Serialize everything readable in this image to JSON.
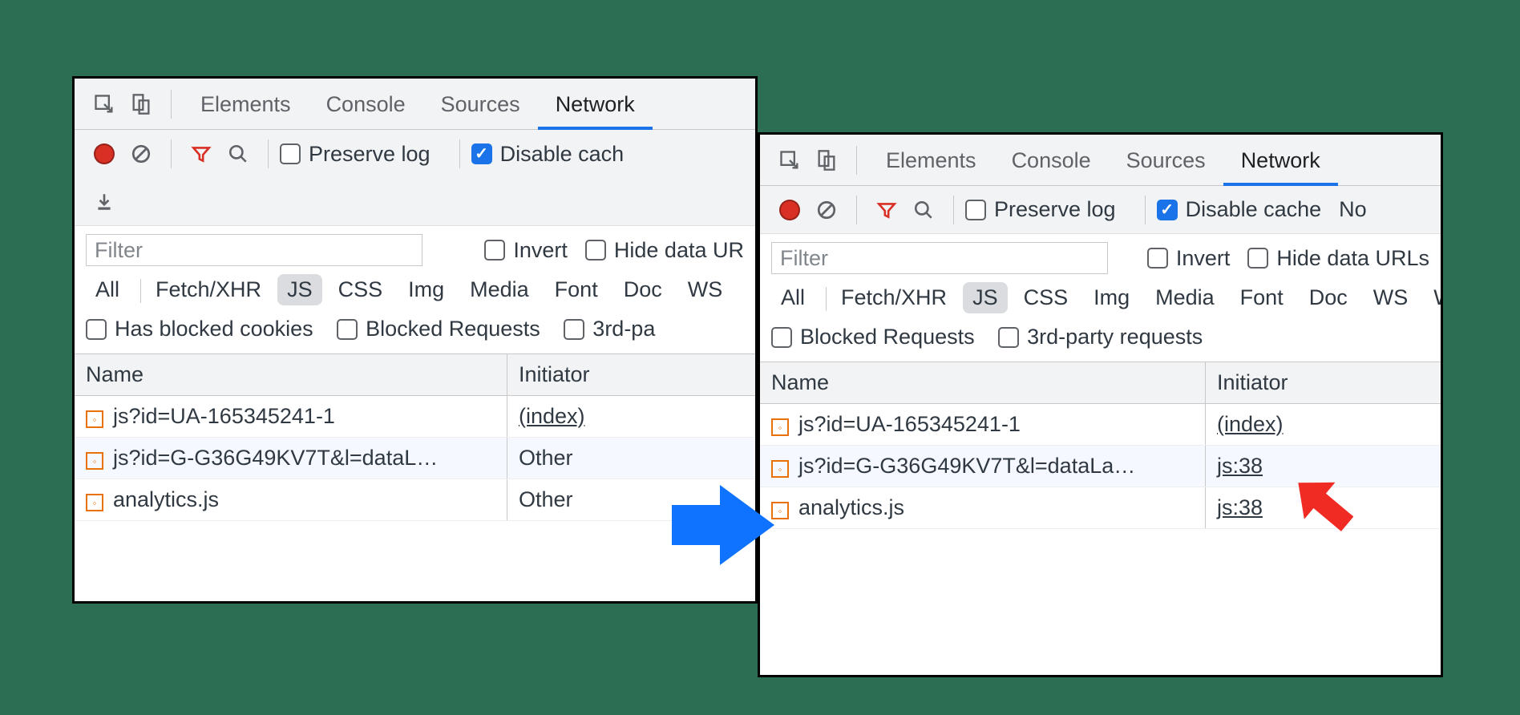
{
  "tabs": [
    "Elements",
    "Console",
    "Sources",
    "Network"
  ],
  "active_tab": "Network",
  "toolbar": {
    "preserve_log": "Preserve log",
    "disable_cache": "Disable cache",
    "disable_cache_cut": "Disable cach",
    "no_throttle_cut": "No"
  },
  "filter": {
    "placeholder": "Filter",
    "invert": "Invert",
    "hide_data_urls": "Hide data URLs",
    "hide_data_urls_cut": "Hide data UR"
  },
  "types": [
    "All",
    "Fetch/XHR",
    "JS",
    "CSS",
    "Img",
    "Media",
    "Font",
    "Doc",
    "WS",
    "Wasm"
  ],
  "type_selected": "JS",
  "opts": {
    "has_blocked_cookies": "Has blocked cookies",
    "blocked_requests": "Blocked Requests",
    "third_party": "3rd-party requests",
    "third_party_cut": "3rd-pa"
  },
  "columns": {
    "name": "Name",
    "initiator": "Initiator"
  },
  "left_rows": [
    {
      "name": "js?id=UA-165345241-1",
      "initiator": "(index)",
      "link": true
    },
    {
      "name": "js?id=G-G36G49KV7T&l=dataL…",
      "initiator": "Other",
      "link": false
    },
    {
      "name": "analytics.js",
      "initiator": "Other",
      "link": false
    }
  ],
  "right_rows": [
    {
      "name": "js?id=UA-165345241-1",
      "initiator": "(index)",
      "link": true
    },
    {
      "name": "js?id=G-G36G49KV7T&l=dataLa…",
      "initiator": "js:38",
      "link": true
    },
    {
      "name": "analytics.js",
      "initiator": "js:38",
      "link": true
    }
  ]
}
